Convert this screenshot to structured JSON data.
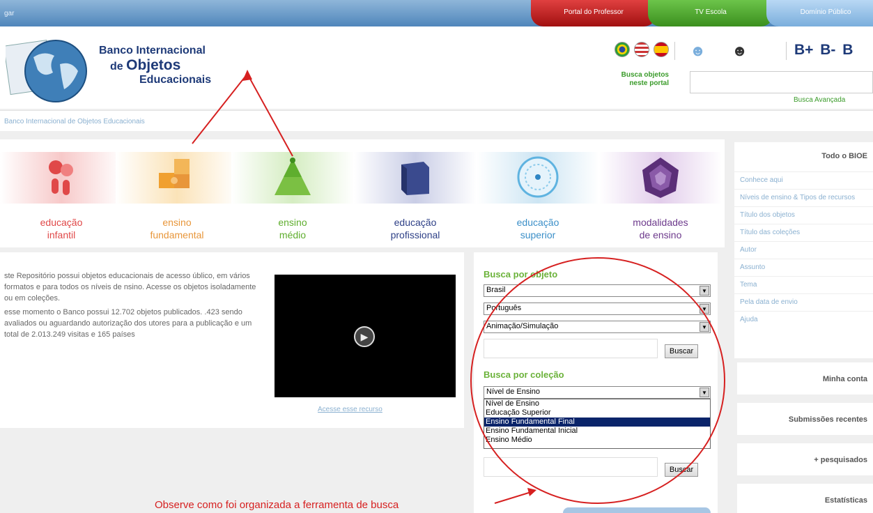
{
  "topbar": {
    "left_text": "gar",
    "tabs": [
      "Portal do Professor",
      "TV Escola",
      "Domínio Público"
    ]
  },
  "header": {
    "logo": {
      "line1": "Banco Internacional",
      "line2_pre": "de ",
      "line2_big": "Objetos",
      "line3": "Educacionais"
    },
    "font_buttons": "B+ B- B",
    "search_label": "Busca objetos neste portal",
    "search_value": "",
    "advanced": "Busca Avançada"
  },
  "breadcrumb": "Banco Internacional de Objetos Educacionais",
  "levels": [
    {
      "line1": "educação",
      "line2": "infantil",
      "color": "#e04848",
      "band": "#f7c9c9",
      "icon": "hands-icon"
    },
    {
      "line1": "ensino",
      "line2": "fundamental",
      "color": "#e8963a",
      "band": "#fbe3b8",
      "icon": "puzzle-icon"
    },
    {
      "line1": "ensino",
      "line2": "médio",
      "color": "#5fae2e",
      "band": "#d5edc2",
      "icon": "pyramid-icon"
    },
    {
      "line1": "educação",
      "line2": "profissional",
      "color": "#2d3f86",
      "band": "#c9cde6",
      "icon": "cube-icon"
    },
    {
      "line1": "educação",
      "line2": "superior",
      "color": "#3b8fc8",
      "band": "#cde5f3",
      "icon": "network-circle-icon"
    },
    {
      "line1": "modalidades",
      "line2": "de ensino",
      "color": "#6d3a8c",
      "band": "#e2cdeb",
      "icon": "dome-icon"
    }
  ],
  "info": {
    "p1": "ste Repositório possui objetos educacionais de acesso úblico, em vários formatos e para todos os níveis de nsino. Acesse os objetos isoladamente ou em coleções.",
    "p2": "esse momento o Banco possui 12.702 objetos publicados. .423 sendo avaliados ou aguardando autorização dos utores para a publicação e um total de 2.013.249 visitas e 165 países",
    "video_link": "Acesse esse recurso"
  },
  "search": {
    "object_title": "Busca por objeto",
    "country": "Brasil",
    "language": "Português",
    "type": "Animação/Simulação",
    "button": "Buscar",
    "collection_title": "Busca por coleção",
    "level_selected": "Nível de Ensino",
    "options": [
      "Nível de Ensino",
      "Educação Superior",
      "Ensino Fundamental Final",
      "Ensino Fundamental Inicial",
      "Ensino Médio"
    ],
    "button2": "Buscar"
  },
  "sidebar": {
    "title": "Todo o BIOE",
    "items": [
      "Conhece aqui",
      "Níveis de ensino & Tipos de recursos",
      "Título dos objetos",
      "Título das coleções",
      "Autor",
      "Assunto",
      "Tema",
      "Pela data de envio",
      "Ajuda"
    ],
    "boxes": [
      "Minha conta",
      "Submissões recentes",
      "+ pesquisados",
      "Estatísticas"
    ]
  },
  "caption": "Observe como foi organizada a ferramenta de busca",
  "colors": {
    "accent_green": "#6bb23a",
    "annotation_red": "#d62020",
    "brand_blue": "#1e3a78"
  }
}
